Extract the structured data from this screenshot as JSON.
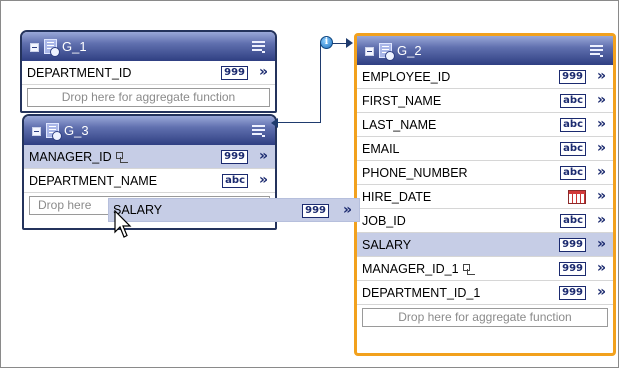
{
  "groups": {
    "g1": {
      "title": "G_1",
      "rows": [
        {
          "name": "DEPARTMENT_ID",
          "type": "999",
          "more": "»"
        }
      ],
      "aggregate_hint": "Drop here for aggregate function"
    },
    "g3": {
      "title": "G_3",
      "rows": [
        {
          "name": "MANAGER_ID",
          "type": "999",
          "more": "»"
        },
        {
          "name": "DEPARTMENT_NAME",
          "type": "abc",
          "more": "»"
        }
      ],
      "aggregate_hint": "Drop here"
    },
    "g2": {
      "title": "G_2",
      "rows": [
        {
          "name": "EMPLOYEE_ID",
          "type": "999",
          "more": "»"
        },
        {
          "name": "FIRST_NAME",
          "type": "abc",
          "more": "»"
        },
        {
          "name": "LAST_NAME",
          "type": "abc",
          "more": "»"
        },
        {
          "name": "EMAIL",
          "type": "abc",
          "more": "»"
        },
        {
          "name": "PHONE_NUMBER",
          "type": "abc",
          "more": "»"
        },
        {
          "name": "HIRE_DATE",
          "type": "",
          "more": "»"
        },
        {
          "name": "JOB_ID",
          "type": "abc",
          "more": "»"
        },
        {
          "name": "SALARY",
          "type": "999",
          "more": "»"
        },
        {
          "name": "MANAGER_ID_1",
          "type": "999",
          "more": "»"
        },
        {
          "name": "DEPARTMENT_ID_1",
          "type": "999",
          "more": "»"
        }
      ],
      "aggregate_hint": "Drop here for aggregate function"
    }
  },
  "dragging": {
    "name": "SALARY",
    "type": "999",
    "more": "»"
  },
  "link": {
    "info_glyph": "i"
  },
  "colors": {
    "header_dark": "#2f3f82",
    "selected_border": "#f2a11d",
    "highlight_row": "#c6cde6"
  }
}
